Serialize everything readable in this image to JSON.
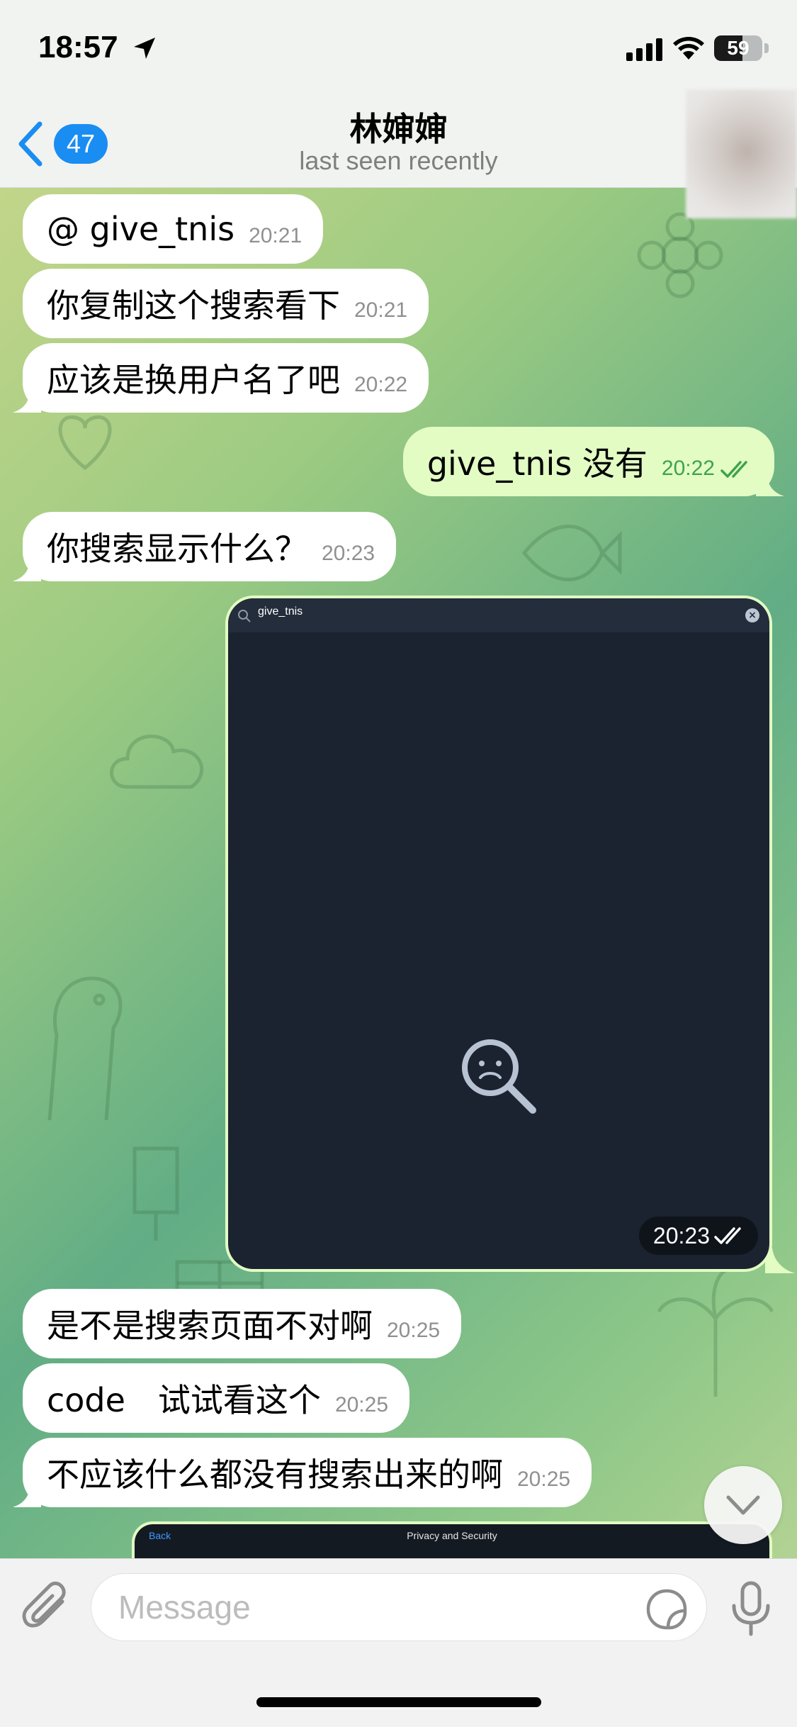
{
  "status_bar": {
    "time": "18:57",
    "battery_percent": "59",
    "battery_level": 0.59
  },
  "header": {
    "back_badge": "47",
    "contact_name": "林婶婶",
    "contact_status": "last seen recently"
  },
  "messages": [
    {
      "direction": "in",
      "text": "@ give_tnis",
      "time": "20:21"
    },
    {
      "direction": "in",
      "text": "你复制这个搜索看下",
      "time": "20:21"
    },
    {
      "direction": "in",
      "text": "应该是换用户名了吧",
      "time": "20:22"
    },
    {
      "direction": "out",
      "text": "give_tnis 没有",
      "time": "20:22",
      "status": "read"
    },
    {
      "direction": "in",
      "text": "你搜索显示什么？",
      "time": "20:23"
    },
    {
      "direction": "out",
      "type": "image",
      "search_text": "give_tnis",
      "time": "20:23",
      "status": "read"
    },
    {
      "direction": "in",
      "text": "是不是搜索页面不对啊",
      "time": "20:25"
    },
    {
      "direction": "in",
      "text": "code　试试看这个",
      "time": "20:25"
    },
    {
      "direction": "in",
      "text": "不应该什么都没有搜索出来的啊",
      "time": "20:25"
    }
  ],
  "partial_image": {
    "back_label": "Back",
    "title": "Privacy and Security"
  },
  "input": {
    "placeholder": "Message"
  },
  "colors": {
    "accent": "#1a8df2",
    "incoming_bubble": "#ffffff",
    "outgoing_bubble": "#e2fcc4",
    "read_check": "#3fa34b"
  },
  "icons": [
    "location-arrow-icon",
    "signal-icon",
    "wifi-icon",
    "battery-icon",
    "chevron-left-icon",
    "double-check-icon",
    "search-icon",
    "clear-icon",
    "sad-search-icon",
    "chevron-down-icon",
    "paperclip-icon",
    "sticker-icon",
    "microphone-icon"
  ]
}
